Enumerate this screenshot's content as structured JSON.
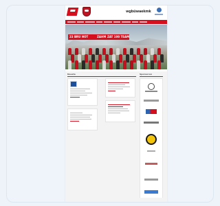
{
  "header": {
    "sponsor_text": "wgbüwaekmk"
  },
  "hero": {
    "banner_1": "23 BRU NOT",
    "banner_2": "ZAHM",
    "banner_3": "ZAT 100 TEAM"
  },
  "main": {
    "left_heading": "Neuste",
    "right_heading": "Sponsoren"
  },
  "colors": {
    "brand_red": "#d40f1e",
    "page_bg": "#eef3f9",
    "content_bg": "#f3f3f3"
  },
  "icons": [
    "club-logo-icon",
    "club-crest-icon",
    "sponsor-logo-icon"
  ]
}
